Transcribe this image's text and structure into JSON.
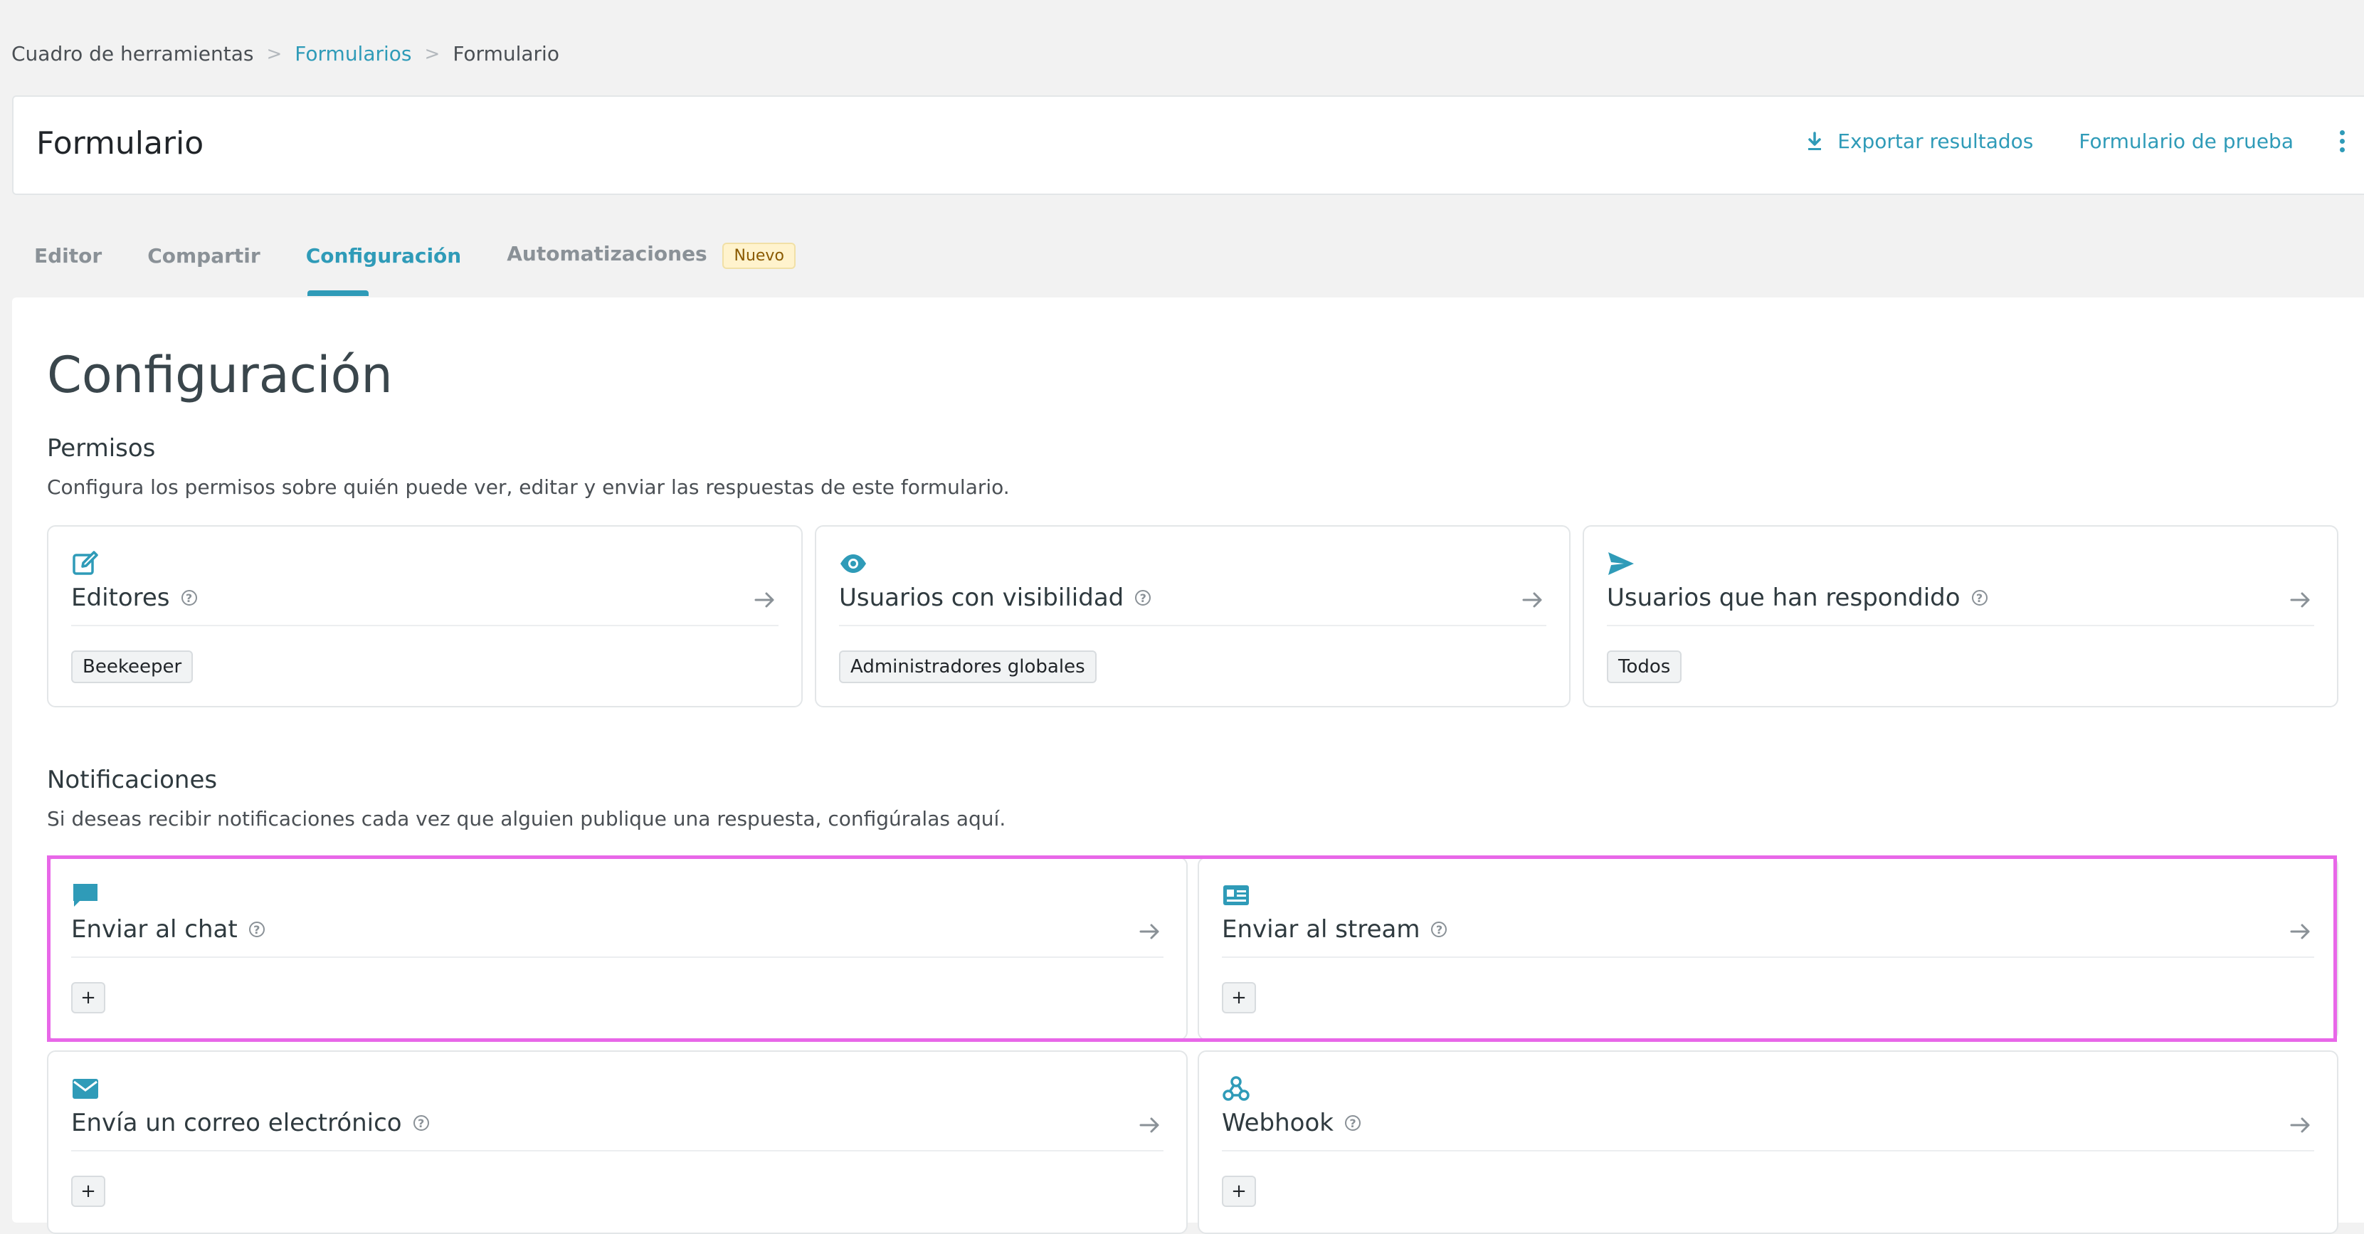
{
  "breadcrumb": {
    "items": [
      {
        "label": "Cuadro de herramientas"
      },
      {
        "label": "Formularios"
      },
      {
        "label": "Formulario"
      }
    ],
    "separator": ">"
  },
  "header": {
    "title": "Formulario",
    "export_label": "Exportar resultados",
    "test_label": "Formulario de prueba"
  },
  "tabs": [
    {
      "label": "Editor"
    },
    {
      "label": "Compartir"
    },
    {
      "label": "Configuración"
    },
    {
      "label": "Automatizaciones",
      "badge": "Nuevo"
    }
  ],
  "page": {
    "title": "Configuración"
  },
  "permissions": {
    "title": "Permisos",
    "description": "Configura los permisos sobre quién puede ver, editar y enviar las respuestas de este formulario.",
    "cards": [
      {
        "title": "Editores",
        "chip": "Beekeeper",
        "icon": "edit-icon"
      },
      {
        "title": "Usuarios con visibilidad",
        "chip": "Administradores globales",
        "icon": "eye-icon"
      },
      {
        "title": "Usuarios que han respondido",
        "chip": "Todos",
        "icon": "send-icon"
      }
    ]
  },
  "notifications": {
    "title": "Notificaciones",
    "description": "Si deseas recibir notificaciones cada vez que alguien publique una respuesta, configúralas aquí.",
    "cards": [
      {
        "title": "Enviar al chat",
        "add": "+",
        "icon": "chat-icon"
      },
      {
        "title": "Enviar al stream",
        "add": "+",
        "icon": "stream-icon"
      },
      {
        "title": "Envía un correo electrónico",
        "add": "+",
        "icon": "mail-icon"
      },
      {
        "title": "Webhook",
        "add": "+",
        "icon": "webhook-icon"
      }
    ]
  },
  "help_glyph": "?",
  "colors": {
    "accent": "#2f9bb8",
    "highlight": "#e867e8",
    "badge_bg": "#fff3cd"
  }
}
